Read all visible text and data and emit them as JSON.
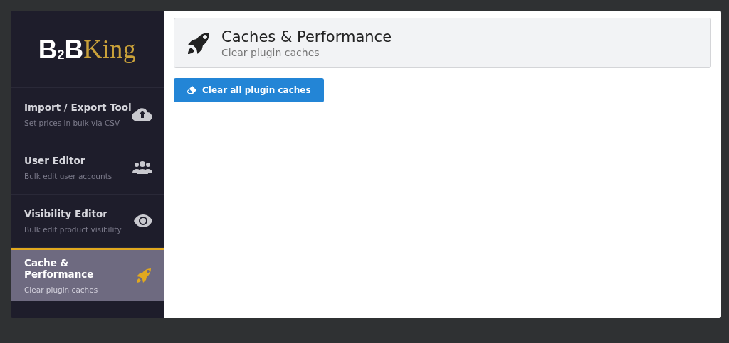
{
  "sidebar": {
    "logo": [
      {
        "text": "B",
        "kind": "main"
      },
      {
        "text": "2",
        "kind": "sub"
      },
      {
        "text": "B",
        "kind": "main"
      },
      {
        "text": "King",
        "kind": "gold"
      }
    ],
    "items": [
      {
        "title": "Import / Export Tool",
        "subtitle": "Set prices in bulk via CSV",
        "selected": false
      },
      {
        "title": "User Editor",
        "subtitle": "Bulk edit user accounts",
        "selected": false
      },
      {
        "title": "Visibility Editor",
        "subtitle": "Bulk edit product visibility",
        "selected": false
      },
      {
        "title": "Cache & Performance",
        "subtitle": "Clear plugin caches",
        "selected": true
      }
    ]
  },
  "header": {
    "title": "Caches & Performance",
    "subtitle": "Clear plugin caches"
  },
  "button": {
    "label": "Clear all plugin caches"
  }
}
